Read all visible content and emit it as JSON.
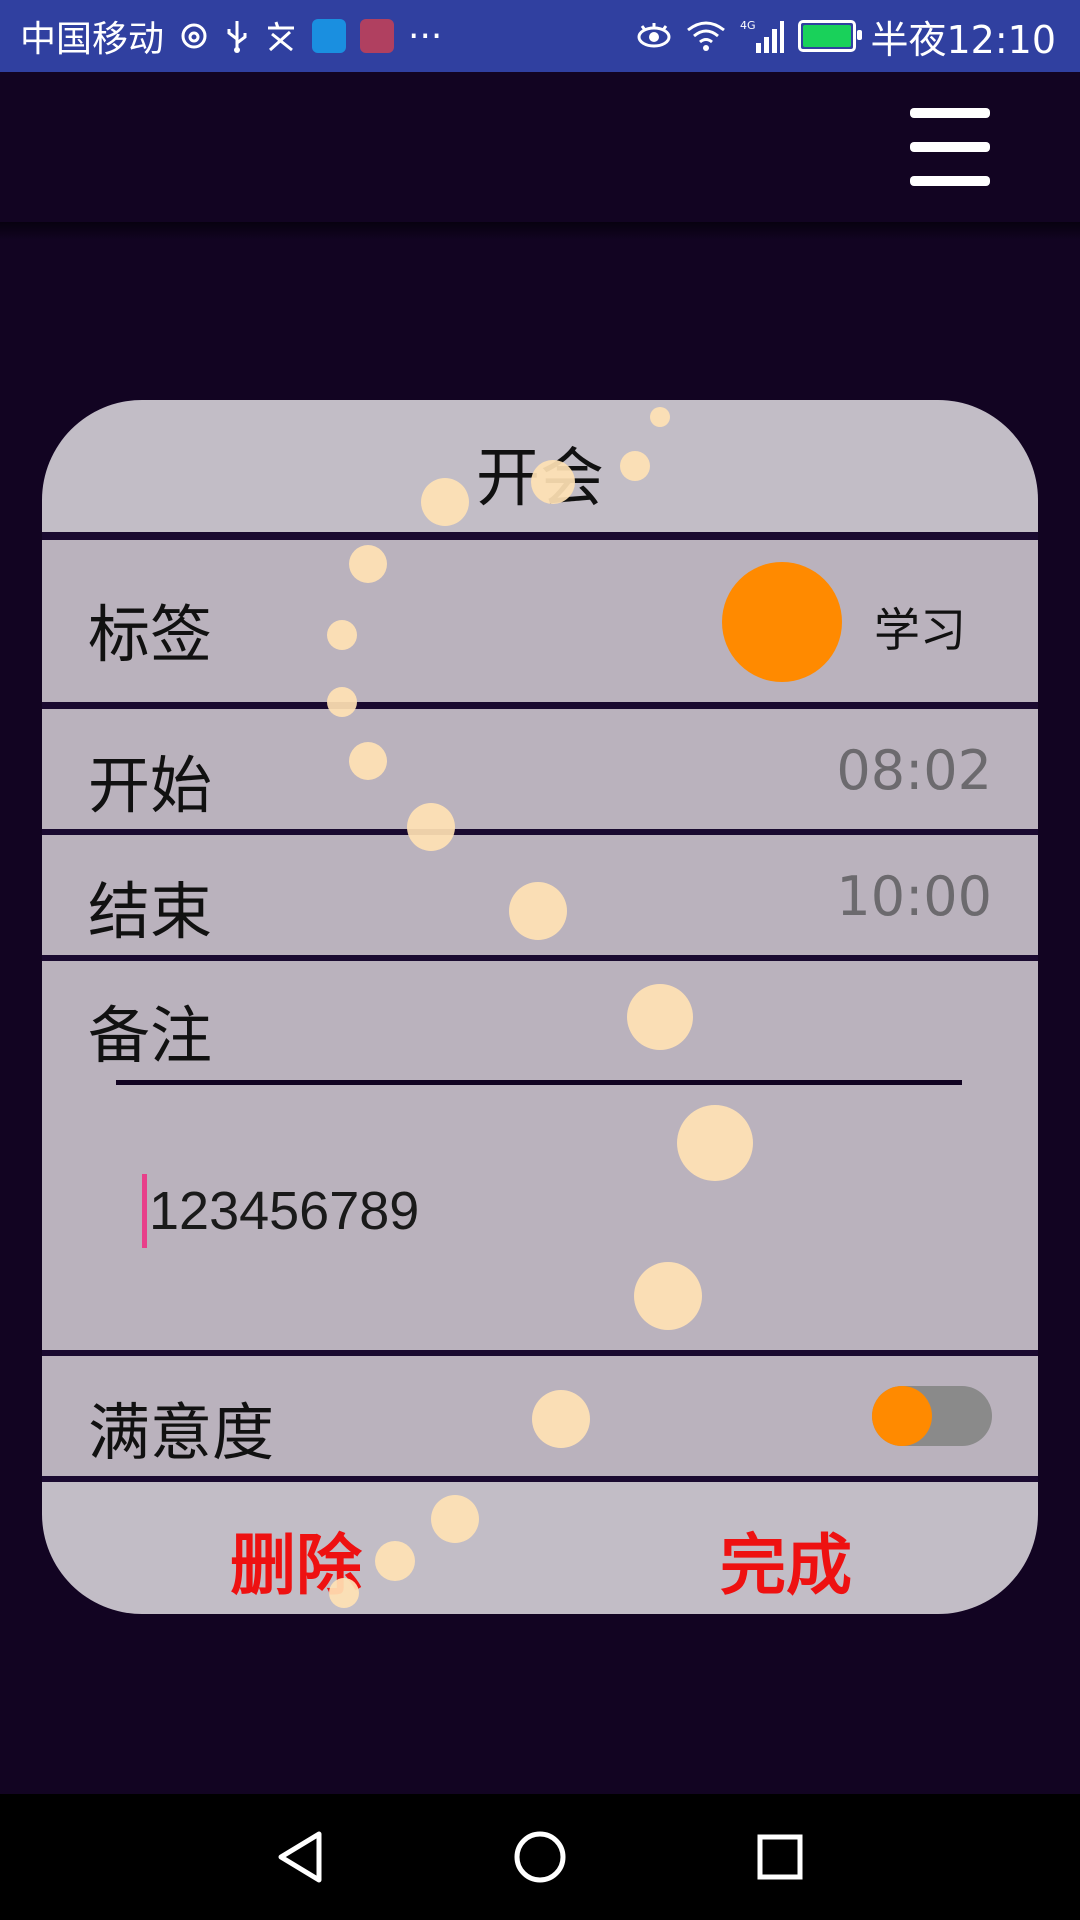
{
  "status_bar": {
    "carrier": "中国移动",
    "more": "···",
    "time": "半夜12:10",
    "network": "4G"
  },
  "toolbar": {
    "menu_icon": "hamburger-menu-icon"
  },
  "card": {
    "title": "开会",
    "tag": {
      "label": "标签",
      "value": "学习",
      "color": "#ff8a00"
    },
    "start": {
      "label": "开始",
      "value": "08:02"
    },
    "end": {
      "label": "结束",
      "value": "10:00"
    },
    "note": {
      "label": "备注",
      "value": "123456789"
    },
    "satisfaction": {
      "label": "满意度",
      "toggle_on": false
    },
    "delete_label": "删除",
    "done_label": "完成"
  },
  "colors": {
    "background": "#120422",
    "status_bar": "#3040a0",
    "accent": "#ff8a00",
    "action_text": "#ee1111",
    "cursor": "#e8408a"
  },
  "nav_bar": {
    "back_icon": "back-triangle-icon",
    "home_icon": "home-circle-icon",
    "recents_icon": "recents-square-icon"
  }
}
